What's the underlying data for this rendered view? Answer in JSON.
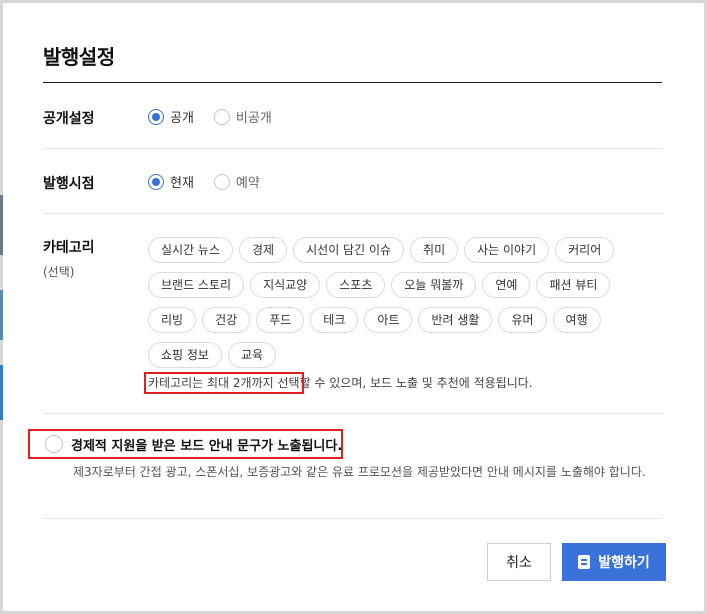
{
  "dialog": {
    "title": "발행설정",
    "visibility": {
      "label": "공개설정",
      "options": [
        "공개",
        "비공개"
      ],
      "selected": "공개"
    },
    "publish_time": {
      "label": "발행시점",
      "options": [
        "현재",
        "예약"
      ],
      "selected": "현재"
    },
    "category": {
      "label": "카테고리",
      "sublabel": "(선택)",
      "chips": [
        "실시간 뉴스",
        "경제",
        "시선이 담긴 이슈",
        "취미",
        "사는 이야기",
        "커리어",
        "브랜드 스토리",
        "지식교양",
        "스포츠",
        "오늘 뭐볼까",
        "연예",
        "패션 뷰티",
        "리빙",
        "건강",
        "푸드",
        "테크",
        "아트",
        "반려 생활",
        "유머",
        "여행",
        "쇼핑 정보",
        "교육"
      ],
      "note_highlight": "카테고리는 최대 2개까지 선택",
      "note_rest": "할 수 있으며, 보드 노출 및 추천에 적용됩니다."
    },
    "sponsorship": {
      "label": "경제적 지원을 받은 보드 안내 문구가 노출됩니다.",
      "checked": false,
      "description": "제3자로부터 간접 광고, 스폰서십, 보증광고와 같은 유료 프로모션을 제공받았다면 안내 메시지를 노출해야 합니다."
    },
    "buttons": {
      "cancel": "취소",
      "publish": "발행하기"
    }
  },
  "colors": {
    "accent": "#3b72d9",
    "highlight_box": "#e0201f"
  }
}
